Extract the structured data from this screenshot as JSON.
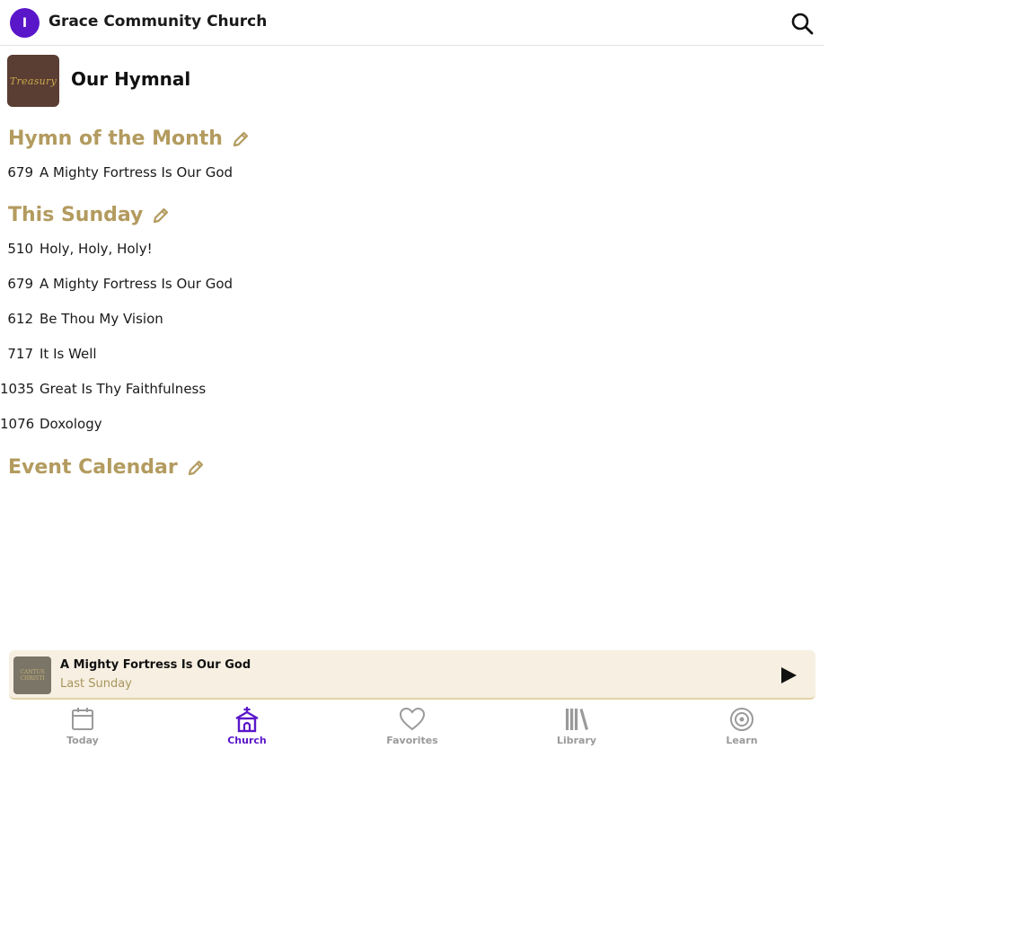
{
  "header": {
    "avatar_initial": "I",
    "church_name": "Grace Community Church"
  },
  "hymnal": {
    "cover_text": "Treasury",
    "title": "Our Hymnal"
  },
  "sections": {
    "hymn_of_month": {
      "heading": "Hymn of the Month",
      "items": [
        {
          "number": "679",
          "title": "A Mighty Fortress Is Our God"
        }
      ]
    },
    "this_sunday": {
      "heading": "This Sunday",
      "items": [
        {
          "number": "510",
          "title": "Holy, Holy, Holy!"
        },
        {
          "number": "679",
          "title": "A Mighty Fortress Is Our God"
        },
        {
          "number": "612",
          "title": "Be Thou My Vision"
        },
        {
          "number": "717",
          "title": "It Is Well"
        },
        {
          "number": "1035",
          "title": "Great Is Thy Faithfulness"
        },
        {
          "number": "1076",
          "title": "Doxology"
        }
      ]
    },
    "event_calendar": {
      "heading": "Event Calendar"
    }
  },
  "player": {
    "title": "A Mighty Fortress Is Our God",
    "subtitle": "Last Sunday",
    "art_text": "CANTUS CHRISTI"
  },
  "tabs": [
    {
      "label": "Today",
      "icon": "calendar-icon",
      "active": false
    },
    {
      "label": "Church",
      "icon": "church-icon",
      "active": true
    },
    {
      "label": "Favorites",
      "icon": "heart-icon",
      "active": false
    },
    {
      "label": "Library",
      "icon": "books-icon",
      "active": false
    },
    {
      "label": "Learn",
      "icon": "target-icon",
      "active": false
    }
  ],
  "colors": {
    "accent": "#5a16c9",
    "heading_gold": "#b39b5f",
    "player_bg": "#f7efe1",
    "inactive_tab": "#9a9a9a"
  }
}
